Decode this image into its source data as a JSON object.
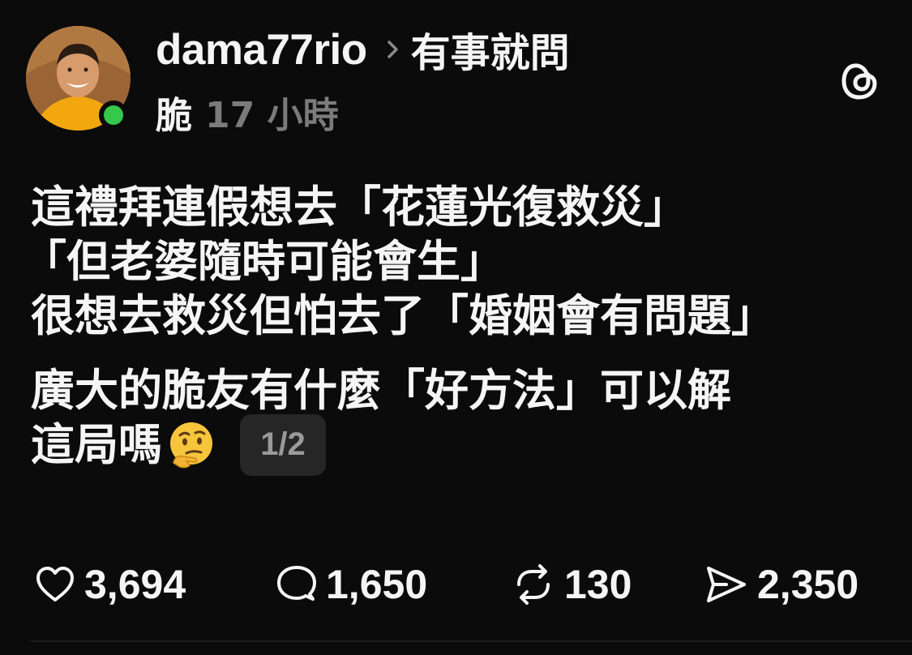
{
  "author": {
    "username": "dama77rio",
    "topic": "有事就問",
    "community": "脆",
    "time_ago": "17 小時",
    "online": true,
    "online_color": "#36c84a"
  },
  "post": {
    "lines": [
      "這禮拜連假想去「花蓮光復救災」",
      "「但老婆隨時可能會生」",
      "很想去救災但怕去了「婚姻會有問題」",
      "廣大的脆友有什麼「好方法」可以解",
      "這局嗎"
    ],
    "emoji": "thinking-face",
    "page_indicator": "1/2"
  },
  "actions": {
    "likes": "3,694",
    "comments": "1,650",
    "reposts": "130",
    "shares": "2,350"
  },
  "icons": {
    "app": "threads-logo-icon",
    "like": "heart-icon",
    "comment": "speech-bubble-icon",
    "repost": "repost-icon",
    "share": "send-icon",
    "separator": "chevron-right-icon"
  },
  "colors": {
    "background": "#0b0b0b",
    "text": "#f5f5f5",
    "muted": "#7b7b7b",
    "badge_bg": "#262626"
  }
}
